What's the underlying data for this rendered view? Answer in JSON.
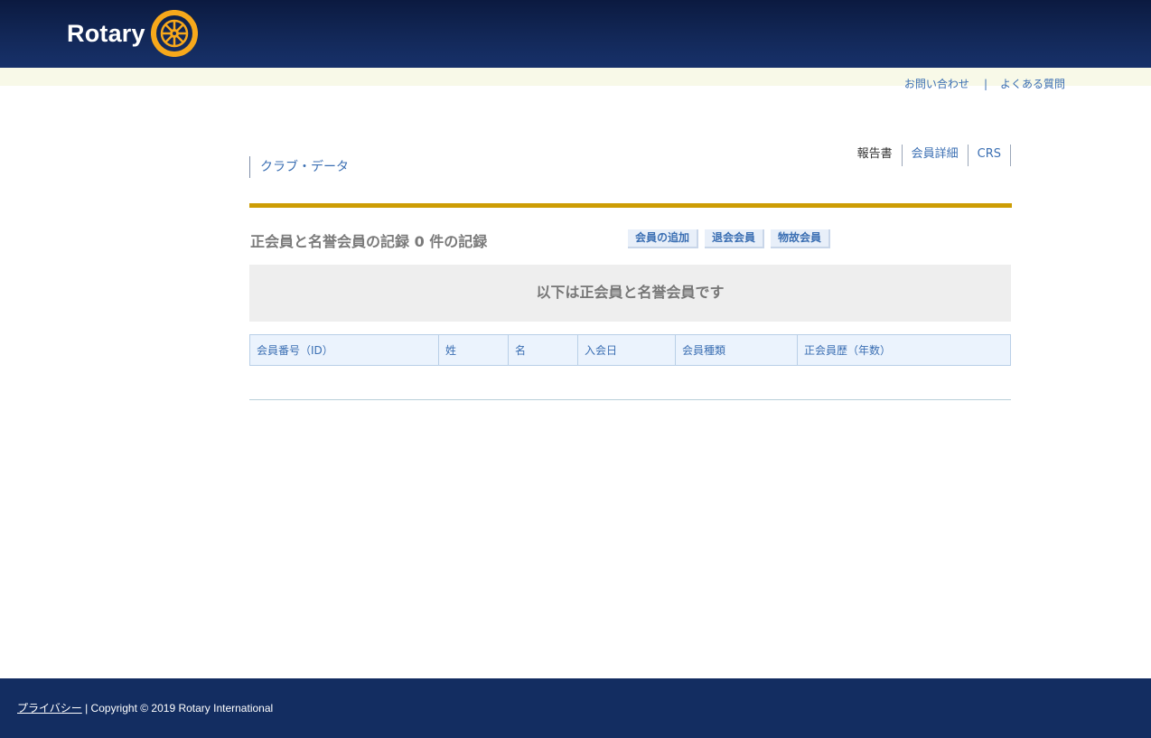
{
  "header": {
    "logo_text": "Rotary",
    "logo_icon": "rotary-wheel-icon",
    "colors": {
      "header_bg": "#13295a",
      "gold": "#cd9d04"
    }
  },
  "util_links": {
    "contact": "お問い合わせ",
    "separator": "|",
    "faq": "よくある質問"
  },
  "page": {
    "club_title": "クラブ・データ"
  },
  "tabs": [
    {
      "label": "報告書",
      "active": true
    },
    {
      "label": "会員詳細",
      "active": false
    },
    {
      "label": "CRS",
      "active": false
    }
  ],
  "records": {
    "heading": "正会員と名誉会員の記録 0 件の記録",
    "actions": {
      "add_member": "会員の追加",
      "terminated": "退会会員",
      "deceased": "物故会員"
    },
    "banner": "以下は正会員と名誉会員です"
  },
  "table": {
    "columns": [
      "会員番号（ID）",
      "姓",
      "名",
      "入会日",
      "会員種類",
      "正会員歴（年数）"
    ],
    "rows": []
  },
  "footer": {
    "privacy": "プライバシー",
    "copyright": " | Copyright © 2019 Rotary International"
  }
}
